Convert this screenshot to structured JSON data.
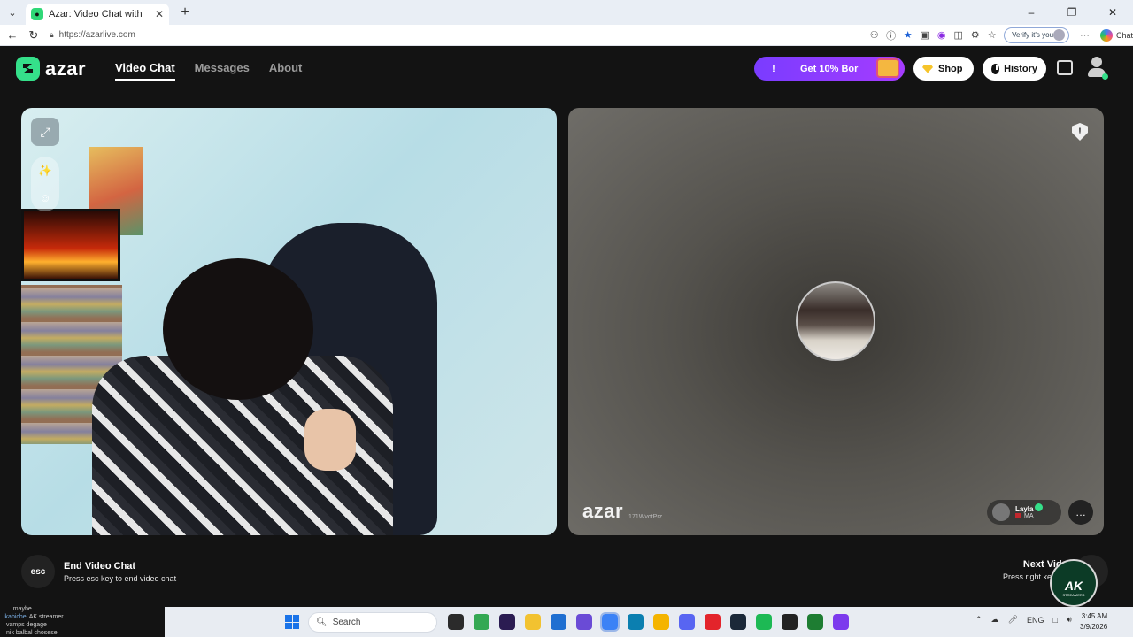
{
  "browser": {
    "tab_title": "Azar: Video Chat with New Pe",
    "tab_favicon": "azar-favicon",
    "new_tab_symbol": "+",
    "url": "https://azarlive.com",
    "verify_label": "Verify it's you",
    "copilot_label": "Chat"
  },
  "header": {
    "logo_text": "azar",
    "nav": [
      {
        "label": "Video Chat",
        "active": true
      },
      {
        "label": "Messages",
        "active": false
      },
      {
        "label": "About",
        "active": false
      }
    ],
    "promo_icon": "!",
    "promo_label": "Get 10% Bor",
    "shop_label": "Shop",
    "history_label": "History"
  },
  "peer": {
    "watermark": "azar",
    "id_text": "171WvotPrz",
    "name": "Layla",
    "country": "MA"
  },
  "hints": {
    "esc_key": "esc",
    "end_title": "End Video Chat",
    "end_sub": "Press esc key to end video chat",
    "next_title": "Next Video Chat",
    "next_sub": "Press right key to meet oth"
  },
  "overlay_badge": {
    "text": "AK",
    "sub": "STREAMERS"
  },
  "stream_chat": [
    {
      "user": "",
      "text": "... maybe ..."
    },
    {
      "user": "ikabiche",
      "text": "AK streamer"
    },
    {
      "user": "",
      "text": "vamps degage"
    },
    {
      "user": "",
      "text": "nik balbal chosese"
    }
  ],
  "taskbar": {
    "search_placeholder": "Search",
    "app_colors": [
      "#2b2b2b",
      "#34a853",
      "#2b1c52",
      "#f2c230",
      "#1f6fd1",
      "#6a4bd6",
      "#3b82f6",
      "#0b7fb0",
      "#f4b400",
      "#5865f2",
      "#e3242b",
      "#1b2838",
      "#1db954",
      "#222222",
      "#1e7d32",
      "#7c3aed"
    ],
    "lang": "ENG",
    "time": "3:45 AM",
    "date": "3/9/2026"
  },
  "colors": {
    "brand_green": "#35e08a",
    "promo_purple": "#8a3cff"
  }
}
